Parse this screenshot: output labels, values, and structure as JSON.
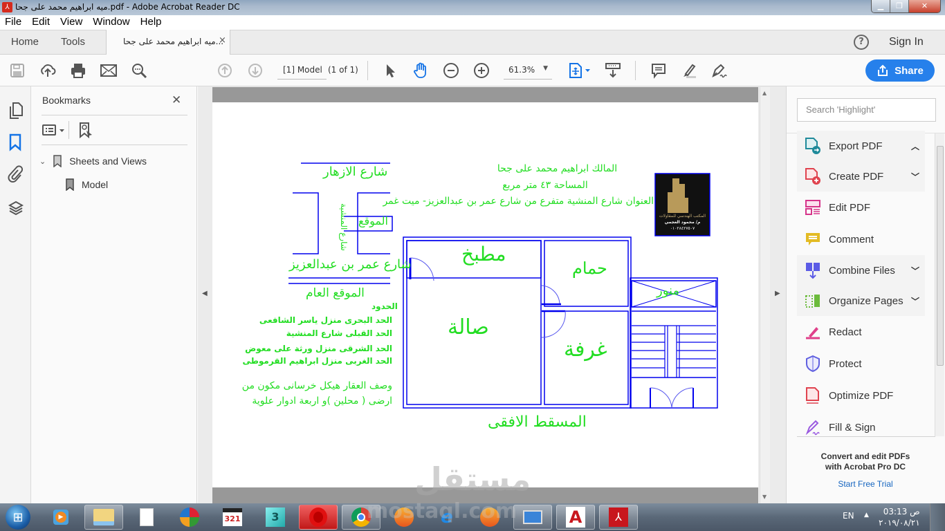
{
  "window": {
    "title": "ميه ابراهيم محمد على جحا.pdf - Adobe Acrobat Reader DC",
    "app_icon": "acrobat-icon",
    "controls": [
      "minimize",
      "restore",
      "close"
    ]
  },
  "menu": [
    "File",
    "Edit",
    "View",
    "Window",
    "Help"
  ],
  "tabs": {
    "home": "Home",
    "tools": "Tools",
    "document": "ميه ابراهيم محمد على جحا...",
    "close": "×"
  },
  "header": {
    "help": "?",
    "sign_in": "Sign In"
  },
  "toolbar": {
    "page_label": "[1] Model",
    "page_count": "(1 of 1)",
    "zoom": "61.3%",
    "share": "Share",
    "icons": [
      "save-icon",
      "upload-cloud-icon",
      "print-icon",
      "email-icon",
      "search-zoom-icon",
      "prev-page-icon",
      "next-page-icon",
      "select-cursor-icon",
      "hand-tool-icon",
      "zoom-out-icon",
      "zoom-in-icon",
      "fit-page-icon",
      "scroll-mode-icon",
      "comment-icon",
      "highlight-icon",
      "sign-icon"
    ]
  },
  "left_rail": [
    "page-thumbnails-icon",
    "bookmarks-icon",
    "attachments-icon",
    "layers-icon"
  ],
  "bookmarks": {
    "title": "Bookmarks",
    "close": "✕",
    "items": [
      {
        "label": "Sheets and Views",
        "expanded": true,
        "level": 0
      },
      {
        "label": "Model",
        "level": 1
      }
    ]
  },
  "document": {
    "header_lines": [
      "المالك  ابراهيم محمد على جحا",
      "المساحة ٤٣ متر مربع",
      "العنوان  شارع المنشية متفرع من شارع عمر بن عبدالعزيز- ميت غمر"
    ],
    "logo": {
      "line1": "المكتب الهندسي للمقاولات",
      "line2": "م/ محمود العجمي",
      "line3": "٠١٠٢٨٤٢٧٥٠٧"
    },
    "site_map": {
      "street_top": "شارع الازهار",
      "street_side": "شارع المنشية",
      "site_label": "الموقع",
      "street_bottom": "شارع عمر بن عبدالعزيز",
      "title": "الموقع العام"
    },
    "boundaries": {
      "title": "الحدود",
      "lines": [
        "الحد البحرى  منزل ياسر الشافعى",
        "الحد القبلى  شارع المنشية",
        "الحد الشرقى  منزل ورثة على معوض",
        "الحد الغربى  منزل ابراهيم القرموطى"
      ]
    },
    "description": [
      "وصف العقار   هيكل خرسانى مكون من",
      "ارضى ( محلين )و اربعة ادوار علوية"
    ],
    "rooms": {
      "kitchen": "مطبخ",
      "bathroom": "حمام",
      "hall": "صالة",
      "room": "غرفة",
      "lightwell": "منور"
    },
    "plan_title": "المسقط الافقى",
    "watermark": "مستقل"
  },
  "tools_panel": {
    "search_placeholder": "Search 'Highlight'",
    "items": [
      {
        "label": "Export PDF",
        "icon": "export-pdf-icon",
        "chevron": "up",
        "color": "#1f8a9a"
      },
      {
        "label": "Create PDF",
        "icon": "create-pdf-icon",
        "chevron": "down",
        "color": "#e0434f"
      },
      {
        "label": "Edit PDF",
        "icon": "edit-pdf-icon",
        "chevron": "",
        "color": "#d6348a"
      },
      {
        "label": "Comment",
        "icon": "comment-icon",
        "chevron": "",
        "color": "#e3bb24"
      },
      {
        "label": "Combine Files",
        "icon": "combine-files-icon",
        "chevron": "down",
        "color": "#5b5be6"
      },
      {
        "label": "Organize Pages",
        "icon": "organize-pages-icon",
        "chevron": "down",
        "color": "#6cbb3c"
      },
      {
        "label": "Redact",
        "icon": "redact-icon",
        "chevron": "",
        "color": "#e0408a"
      },
      {
        "label": "Protect",
        "icon": "protect-icon",
        "chevron": "",
        "color": "#6060e0"
      },
      {
        "label": "Optimize PDF",
        "icon": "optimize-pdf-icon",
        "chevron": "",
        "color": "#e0434f"
      },
      {
        "label": "Fill & Sign",
        "icon": "fill-sign-icon",
        "chevron": "",
        "color": "#9a5ae0"
      }
    ],
    "promo": [
      "Convert and edit PDFs",
      "with Acrobat Pro DC"
    ],
    "trial": "Start Free Trial"
  },
  "taskbar": {
    "apps": [
      "start-button",
      "media-player",
      "file-explorer",
      "blank-document",
      "app-installer",
      "media-player-classic",
      "3ds-max",
      "opera",
      "chrome",
      "app-1",
      "internet-explorer",
      "app-2",
      "on-screen-keyboard",
      "autocad",
      "acrobat-reader"
    ],
    "language": "EN",
    "time": "03:13 ص",
    "date": "٢٠١٩/٠٨/٢١",
    "watermark": "mostaql.com"
  },
  "colors": {
    "accent": "#2680eb",
    "drawing_lines": "#0000ee",
    "drawing_text": "#22dd22"
  }
}
